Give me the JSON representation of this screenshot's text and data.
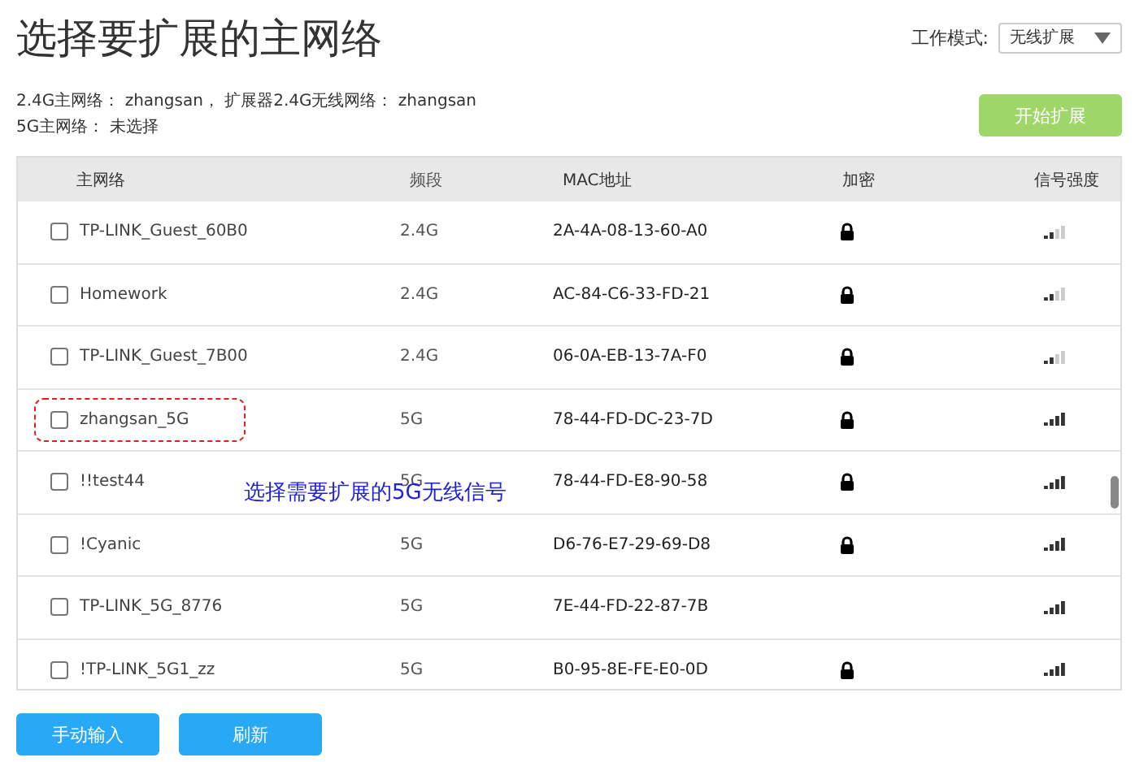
{
  "title": "选择要扩展的主网络",
  "mode": {
    "label": "工作模式:",
    "value": "无线扩展"
  },
  "info": [
    "2.4G主网络： zhangsan， 扩展器2.4G无线网络： zhangsan",
    "5G主网络： 未选择"
  ],
  "start_button": "开始扩展",
  "table": {
    "columns": [
      "主网络",
      "频段",
      "MAC地址",
      "加密",
      "信号强度"
    ],
    "rows": [
      {
        "name": "TP-LINK_Guest_60B0",
        "band": "2.4G",
        "mac": "2A-4A-08-13-60-A0",
        "checked": false,
        "encrypted": true,
        "kind": "weak",
        "highlighted": false
      },
      {
        "name": "Homework",
        "band": "2.4G",
        "mac": "AC-84-C6-33-FD-21",
        "checked": false,
        "encrypted": true,
        "kind": "weak",
        "highlighted": false
      },
      {
        "name": "TP-LINK_Guest_7B00",
        "band": "2.4G",
        "mac": "06-0A-EB-13-7A-F0",
        "checked": false,
        "encrypted": true,
        "kind": "weak",
        "highlighted": false
      },
      {
        "name": "zhangsan_5G",
        "band": "5G",
        "mac": "78-44-FD-DC-23-7D",
        "checked": false,
        "encrypted": true,
        "kind": "strong",
        "highlighted": true
      },
      {
        "name": "!!test44",
        "band": "5G",
        "mac": "78-44-FD-E8-90-58",
        "checked": false,
        "encrypted": true,
        "kind": "strong",
        "highlighted": false
      },
      {
        "name": "!Cyanic",
        "band": "5G",
        "mac": "D6-76-E7-29-69-D8",
        "checked": false,
        "encrypted": true,
        "kind": "strong",
        "highlighted": false
      },
      {
        "name": "TP-LINK_5G_8776",
        "band": "5G",
        "mac": "7E-44-FD-22-87-7B",
        "checked": false,
        "encrypted": false,
        "kind": "strong",
        "highlighted": false
      },
      {
        "name": "!TP-LINK_5G1_zz",
        "band": "5G",
        "mac": "B0-95-8E-FE-E0-0D",
        "checked": false,
        "encrypted": true,
        "kind": "strong",
        "highlighted": false
      }
    ]
  },
  "annotation": "选择需要扩展的5G无线信号",
  "buttons": [
    "手动输入",
    "刷新"
  ]
}
